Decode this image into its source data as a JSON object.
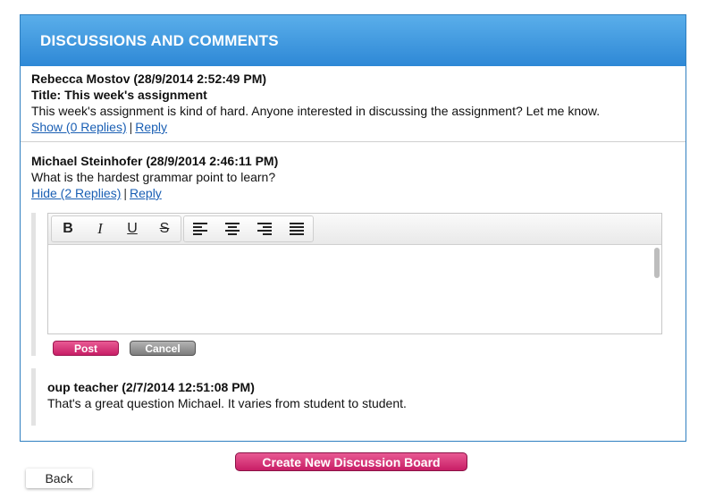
{
  "header": {
    "title": "DISCUSSIONS AND COMMENTS"
  },
  "posts": [
    {
      "author": "Rebecca Mostov (28/9/2014 2:52:49 PM)",
      "title": "Title: This week's assignment",
      "body": "This week's assignment is kind of hard. Anyone interested in discussing the assignment? Let me know.",
      "toggle_label": "Show (0 Replies)",
      "reply_label": "Reply",
      "separator": "|"
    },
    {
      "author": "Michael Steinhofer (28/9/2014 2:46:11 PM)",
      "body": "What is the hardest grammar point to learn?",
      "toggle_label": "Hide (2 Replies)",
      "reply_label": "Reply",
      "separator": "|"
    }
  ],
  "editor": {
    "toolbar": {
      "bold": "B",
      "italic": "I",
      "underline": "U",
      "strike": "S",
      "align_icons": [
        "align-left-icon",
        "align-center-icon",
        "align-right-icon",
        "align-justify-icon"
      ]
    },
    "post_label": "Post",
    "cancel_label": "Cancel"
  },
  "reply": {
    "author": "oup teacher (2/7/2014 12:51:08 PM)",
    "body": "That's a great question Michael. It varies from student to student."
  },
  "footer": {
    "create_label": "Create New Discussion Board",
    "back_label": "Back"
  },
  "colors": {
    "header_gradient_top": "#5aaeea",
    "header_gradient_bottom": "#2e88d6",
    "link": "#1a5fb4",
    "primary_button": "#d63a7c",
    "cancel_button": "#9a9a9a"
  }
}
